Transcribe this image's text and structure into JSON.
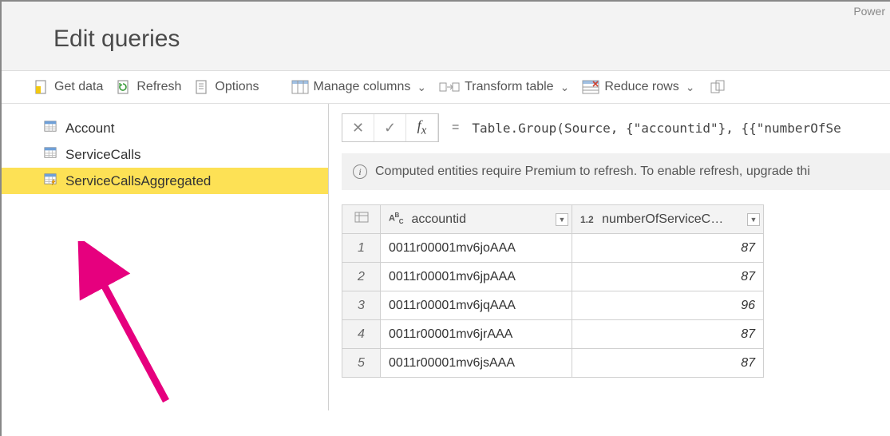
{
  "app_name": "Power",
  "header": {
    "title": "Edit queries"
  },
  "toolbar": {
    "get_data": "Get data",
    "refresh": "Refresh",
    "options": "Options",
    "manage_columns": "Manage columns",
    "transform_table": "Transform table",
    "reduce_rows": "Reduce rows"
  },
  "sidebar": {
    "items": [
      {
        "label": "Account",
        "selected": false,
        "computed": false
      },
      {
        "label": "ServiceCalls",
        "selected": false,
        "computed": false
      },
      {
        "label": "ServiceCallsAggregated",
        "selected": true,
        "computed": true
      }
    ]
  },
  "fx": {
    "formula": "Table.Group(Source, {\"accountid\"}, {{\"numberOfSe"
  },
  "banner": {
    "text": "Computed entities require Premium to refresh. To enable refresh, upgrade thi"
  },
  "table": {
    "columns": [
      {
        "type": "text",
        "label": "accountid"
      },
      {
        "type": "decimal",
        "label": "numberOfServiceC…"
      }
    ],
    "rows": [
      {
        "n": "1",
        "accountid": "0011r00001mv6joAAA",
        "val": "87"
      },
      {
        "n": "2",
        "accountid": "0011r00001mv6jpAAA",
        "val": "87"
      },
      {
        "n": "3",
        "accountid": "0011r00001mv6jqAAA",
        "val": "96"
      },
      {
        "n": "4",
        "accountid": "0011r00001mv6jrAAA",
        "val": "87"
      },
      {
        "n": "5",
        "accountid": "0011r00001mv6jsAAA",
        "val": "87"
      }
    ]
  }
}
